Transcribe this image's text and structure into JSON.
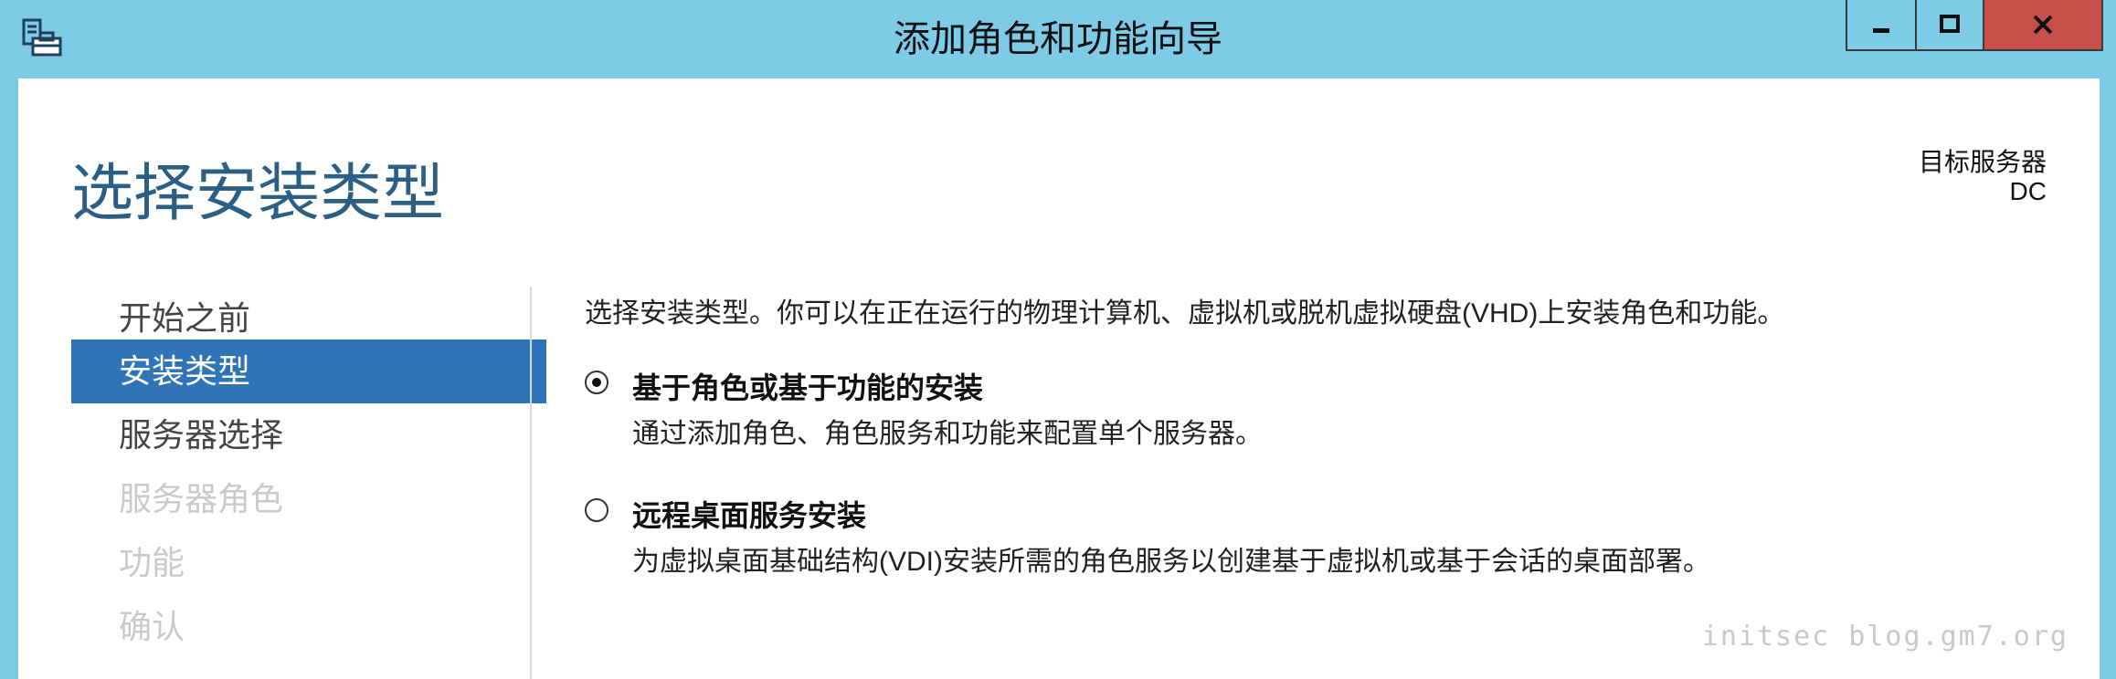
{
  "window": {
    "title": "添加角色和功能向导"
  },
  "header": {
    "page_title": "选择安装类型",
    "target_label": "目标服务器",
    "target_value": "DC"
  },
  "sidebar": {
    "items": [
      {
        "label": "开始之前",
        "state": "normal"
      },
      {
        "label": "安装类型",
        "state": "selected"
      },
      {
        "label": "服务器选择",
        "state": "normal"
      },
      {
        "label": "服务器角色",
        "state": "disabled"
      },
      {
        "label": "功能",
        "state": "disabled"
      },
      {
        "label": "确认",
        "state": "disabled"
      }
    ]
  },
  "main": {
    "intro": "选择安装类型。你可以在正在运行的物理计算机、虚拟机或脱机虚拟硬盘(VHD)上安装角色和功能。",
    "options": [
      {
        "label": "基于角色或基于功能的安装",
        "description": "通过添加角色、角色服务和功能来配置单个服务器。",
        "checked": true
      },
      {
        "label": "远程桌面服务安装",
        "description": "为虚拟桌面基础结构(VDI)安装所需的角色服务以创建基于虚拟机或基于会话的桌面部署。",
        "checked": false
      }
    ]
  },
  "watermark": "initsec blog.gm7.org",
  "colors": {
    "titlebar": "#7ecbe8",
    "accent": "#2e74b7",
    "page_title": "#2b5f84",
    "close_button": "#c7504a"
  },
  "icons": {
    "app": "server-manager-icon",
    "minimize": "minimize-icon",
    "maximize": "maximize-icon",
    "close": "close-icon"
  }
}
